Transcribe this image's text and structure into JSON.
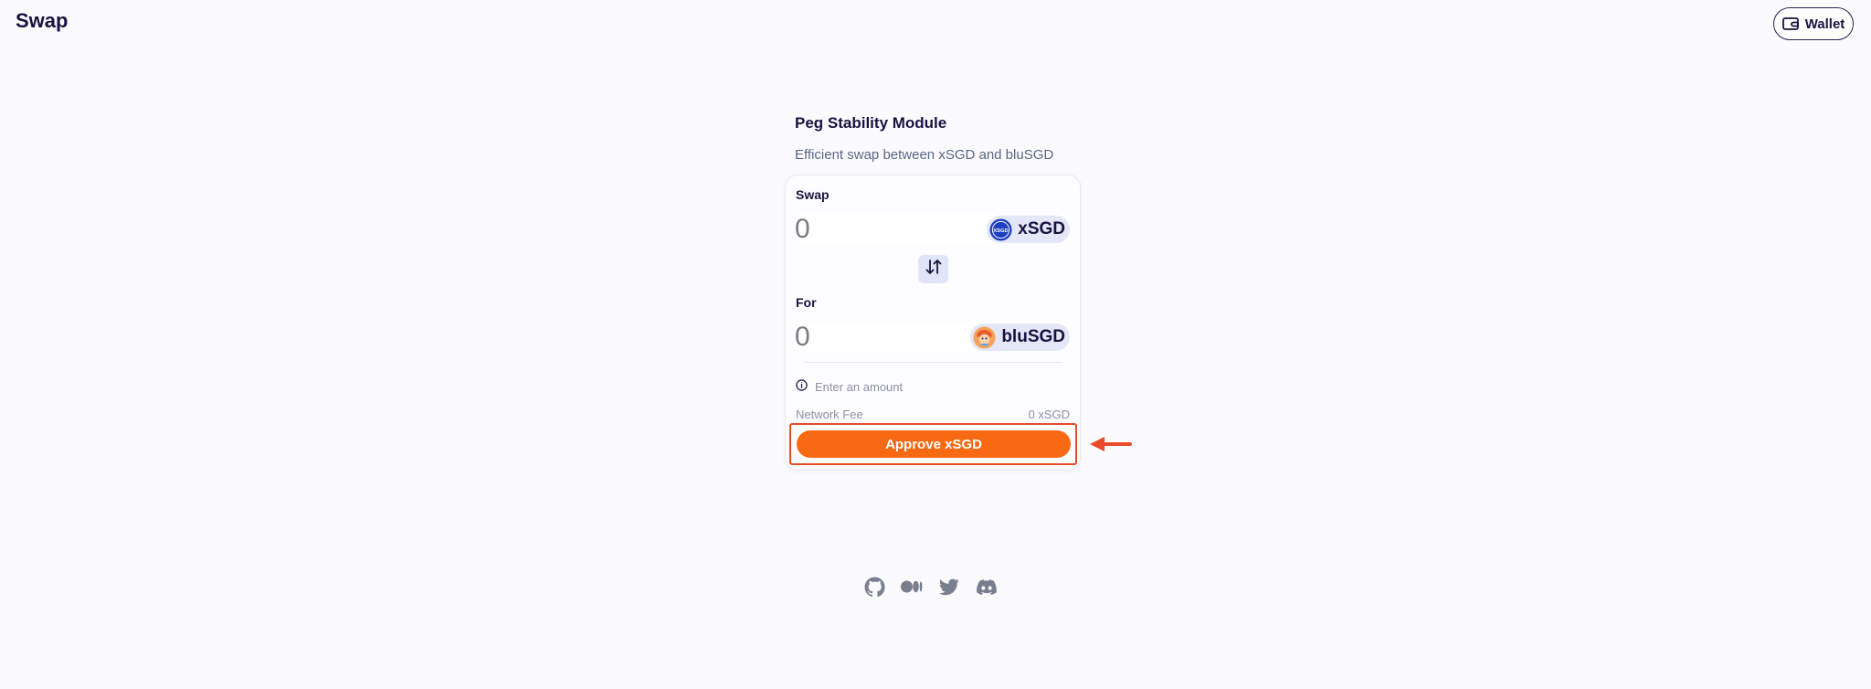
{
  "header": {
    "title": "Swap",
    "wallet_label": "Wallet"
  },
  "psm": {
    "title": "Peg Stability Module",
    "subtitle": "Efficient swap between xSGD and bluSGD"
  },
  "swap": {
    "from_label": "Swap",
    "from_amount_placeholder": "0",
    "from_token": "xSGD",
    "from_token_icon_text": "XSGD",
    "to_label": "For",
    "to_amount_placeholder": "0",
    "to_token": "bluSGD"
  },
  "info": {
    "message": "Enter an amount"
  },
  "fee": {
    "label": "Network Fee",
    "value": "0 xSGD"
  },
  "action": {
    "approve_label": "Approve xSGD"
  },
  "footer": {
    "social_icons": [
      "github-icon",
      "medium-icon",
      "twitter-icon",
      "discord-icon"
    ]
  },
  "colors": {
    "accent": "#f76912",
    "annotation": "#e84a2a",
    "text_dark": "#1b1140",
    "pill_bg": "#e3e7f7"
  }
}
